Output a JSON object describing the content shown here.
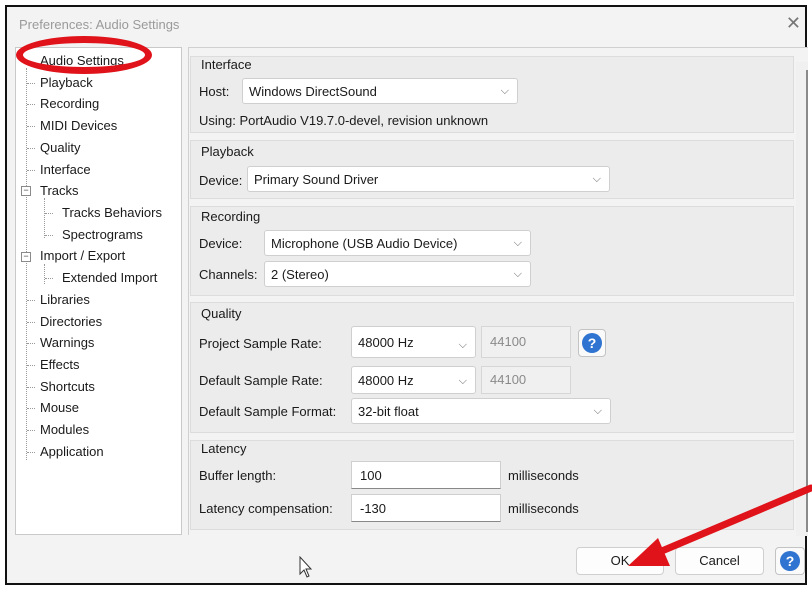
{
  "window": {
    "title": "Preferences: Audio Settings",
    "close_icon": "close-icon"
  },
  "tree": {
    "items": [
      {
        "label": "Audio Settings",
        "selected": true
      },
      {
        "label": "Playback"
      },
      {
        "label": "Recording"
      },
      {
        "label": "MIDI Devices"
      },
      {
        "label": "Quality"
      },
      {
        "label": "Interface"
      },
      {
        "label": "Tracks",
        "expander": "⊟"
      },
      {
        "label": "Tracks Behaviors"
      },
      {
        "label": "Spectrograms"
      },
      {
        "label": "Import / Export",
        "expander": "⊟"
      },
      {
        "label": "Extended Import"
      },
      {
        "label": "Libraries"
      },
      {
        "label": "Directories"
      },
      {
        "label": "Warnings"
      },
      {
        "label": "Effects"
      },
      {
        "label": "Shortcuts"
      },
      {
        "label": "Mouse"
      },
      {
        "label": "Modules"
      },
      {
        "label": "Application"
      }
    ]
  },
  "interface": {
    "title": "Interface",
    "host_label": "Host:",
    "host_value": "Windows DirectSound",
    "using_text": "Using: PortAudio V19.7.0-devel, revision unknown"
  },
  "playback": {
    "title": "Playback",
    "device_label": "Device:",
    "device_value": "Primary Sound Driver"
  },
  "recording": {
    "title": "Recording",
    "device_label": "Device:",
    "device_value": "Microphone (USB Audio Device)",
    "channels_label": "Channels:",
    "channels_value": "2 (Stereo)"
  },
  "quality": {
    "title": "Quality",
    "project_rate_label": "Project Sample Rate:",
    "project_rate_value": "48000 Hz",
    "project_rate_other": "44100",
    "default_rate_label": "Default Sample Rate:",
    "default_rate_value": "48000 Hz",
    "default_rate_other": "44100",
    "format_label": "Default Sample Format:",
    "format_value": "32-bit float"
  },
  "latency": {
    "title": "Latency",
    "buffer_label": "Buffer length:",
    "buffer_value": "100",
    "buffer_unit": "milliseconds",
    "comp_label": "Latency compensation:",
    "comp_value": "-130",
    "comp_unit": "milliseconds"
  },
  "buttons": {
    "ok": "OK",
    "cancel": "Cancel",
    "help_glyph": "?"
  },
  "glyphs": {
    "chevron": "⌵"
  },
  "colors": {
    "annotation_red": "#e0131a",
    "help_blue": "#2f74d0"
  }
}
